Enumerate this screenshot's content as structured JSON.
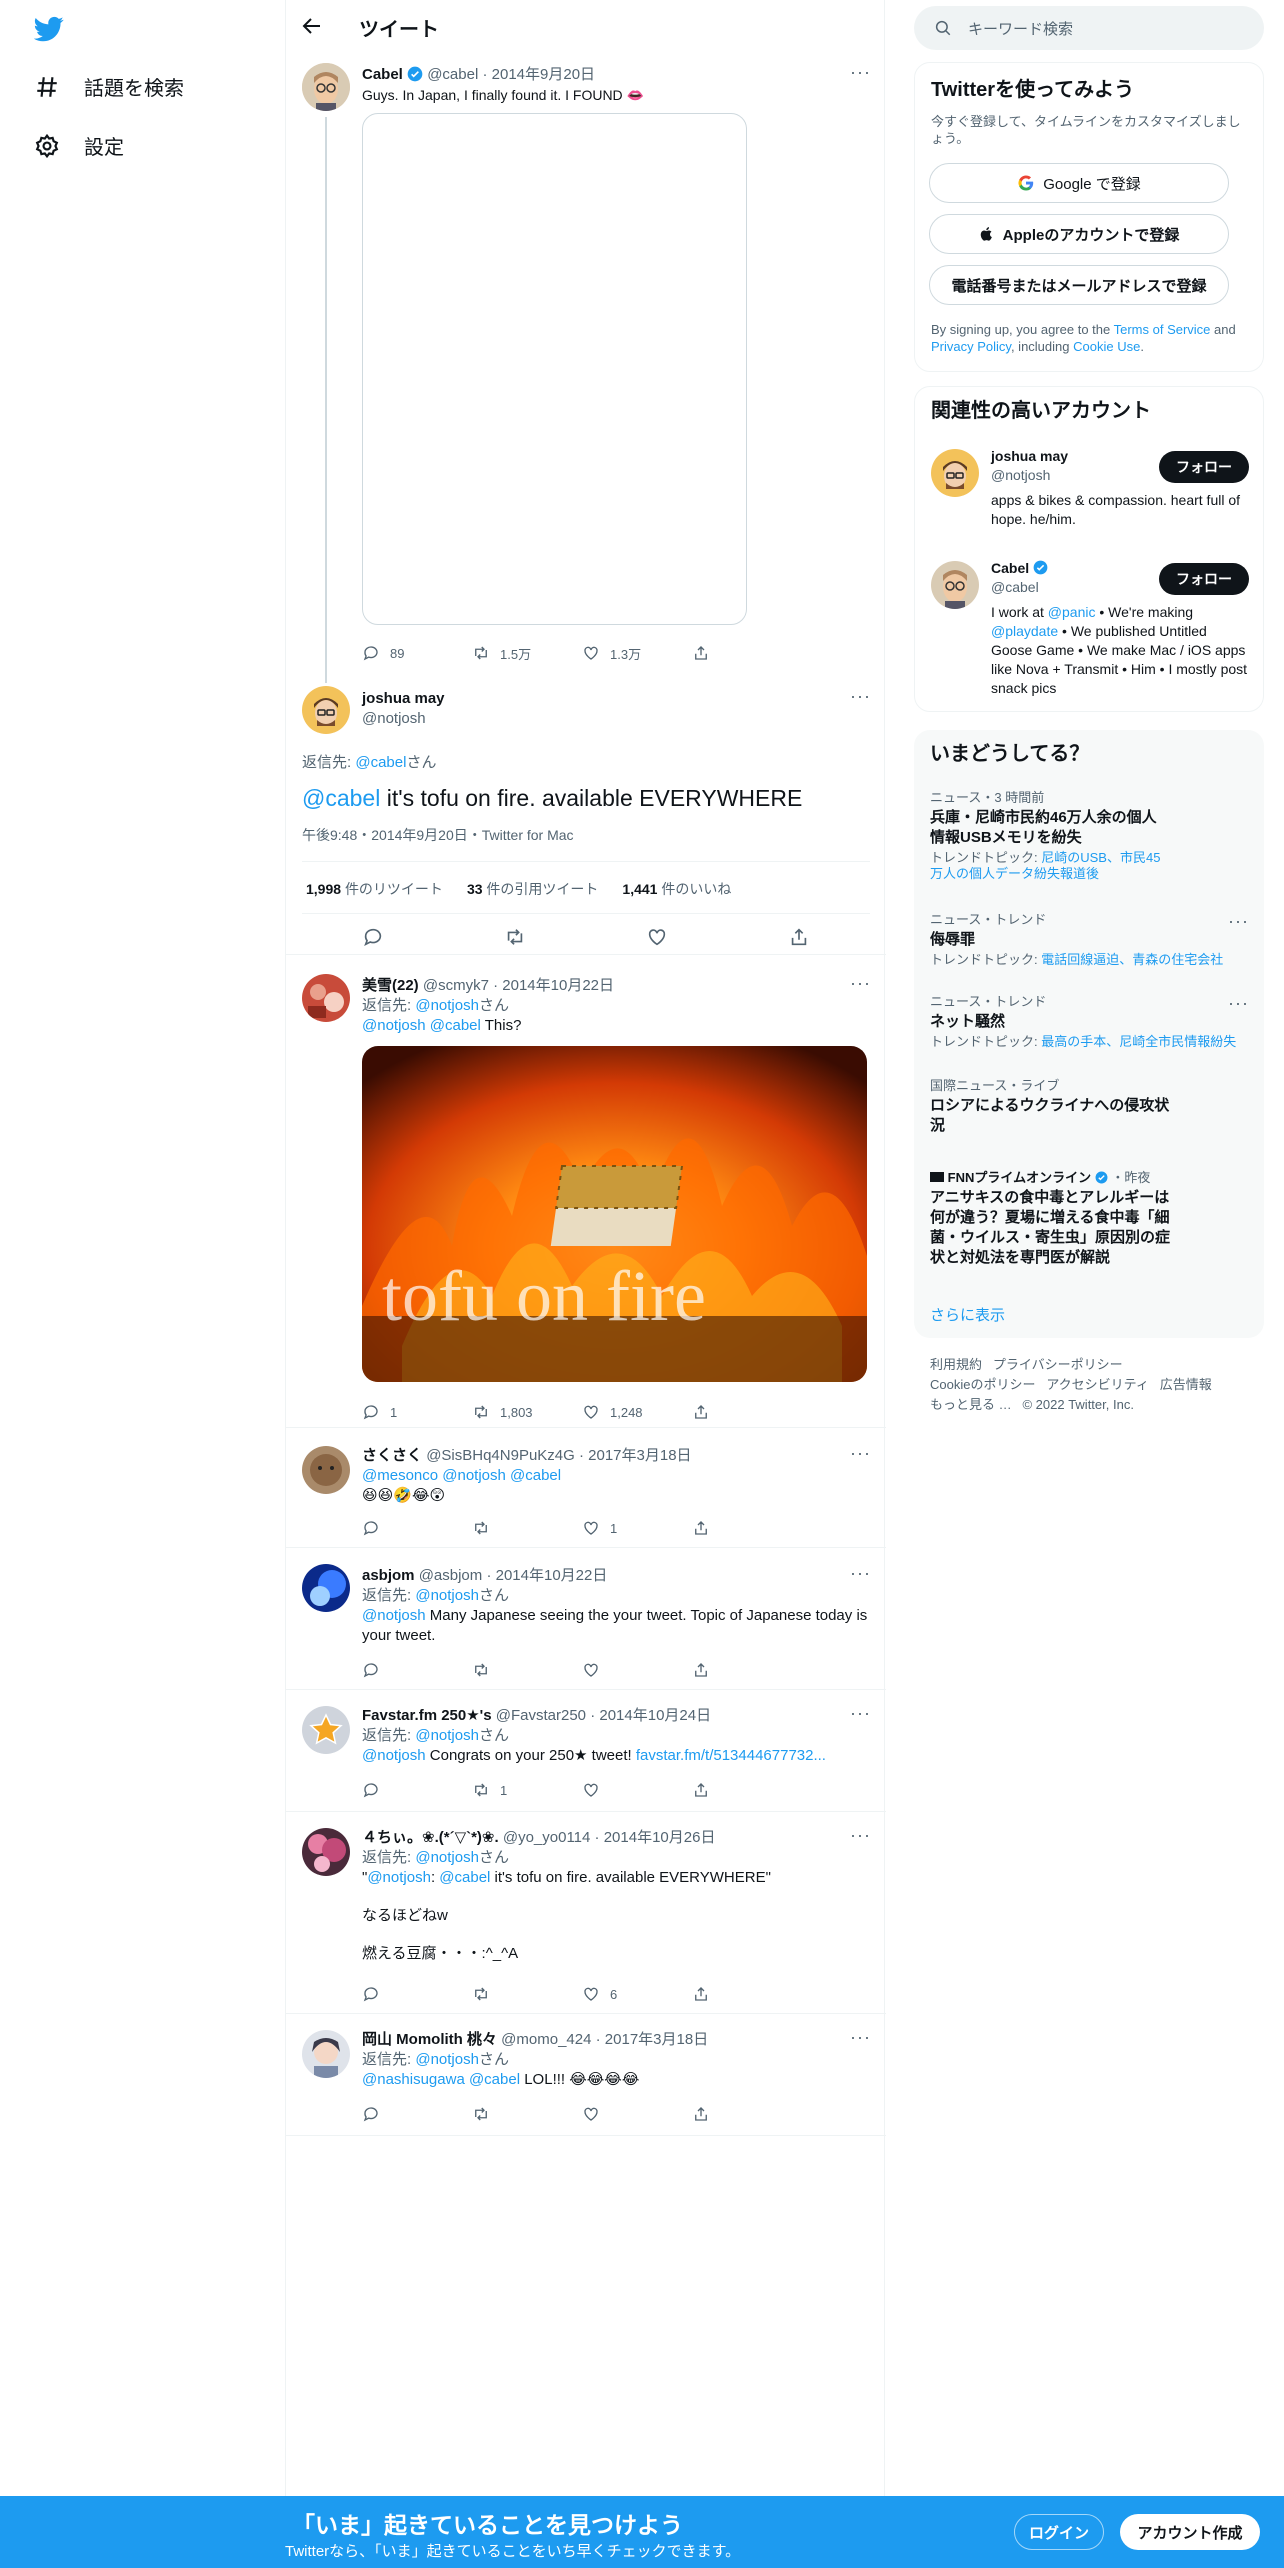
{
  "nav": {
    "items": [
      {
        "label": "話題を検索",
        "icon": "hashtag-icon"
      },
      {
        "label": "設定",
        "icon": "gear-icon"
      }
    ]
  },
  "header": {
    "title": "ツイート"
  },
  "main_tweet": {
    "name": "Cabel",
    "handle": "@cabel",
    "date": "2014年9月20日",
    "text": "Guys. In Japan, I finally found it. I FOUND 👄",
    "replies": "89",
    "retweets": "1.5万",
    "likes": "1.3万"
  },
  "focus_tweet": {
    "name": "joshua may",
    "handle": "@notjosh",
    "reply_prefix": "返信先: ",
    "reply_to": "@cabel",
    "reply_suffix": "さん",
    "mention": "@cabel",
    "text": " it's tofu on fire. available EVERYWHERE",
    "meta": "午後9:48・2014年9月20日・Twitter for Mac",
    "stats": [
      {
        "count": "1,998",
        "label": "件のリツイート"
      },
      {
        "count": "33",
        "label": "件の引用ツイート"
      },
      {
        "count": "1,441",
        "label": "件のいいね"
      }
    ]
  },
  "replies": [
    {
      "name": "美雪(22)",
      "handle": "@scmyk7",
      "date": "2014年10月22日",
      "reply_to": "@notjosh",
      "mentions": "@notjosh @cabel",
      "text": " This?",
      "image_caption": "tofu on fire",
      "reply_count": "1",
      "retweets": "1,803",
      "likes": "1,248"
    },
    {
      "name": "さくさく",
      "handle": "@SisBHq4N9PuKz4G",
      "date": "2017年3月18日",
      "mentions": "@mesonco @notjosh @cabel",
      "text": "😆😆🤣😂😲",
      "reply_count": "",
      "retweets": "",
      "likes": "1"
    },
    {
      "name": "asbjom",
      "handle": "@asbjom",
      "date": "2014年10月22日",
      "reply_to": "@notjosh",
      "mentions": "@notjosh",
      "text": " Many Japanese seeing the your tweet. Topic of Japanese today is your tweet.",
      "reply_count": "",
      "retweets": "",
      "likes": ""
    },
    {
      "name": "Favstar.fm 250★'s",
      "handle": "@Favstar250",
      "date": "2014年10月24日",
      "reply_to": "@notjosh",
      "mentions": "@notjosh",
      "text": " Congrats on your 250★ tweet! ",
      "link": "favstar.fm/t/513444677732...",
      "reply_count": "",
      "retweets": "1",
      "likes": ""
    },
    {
      "name": "４ちぃ。❀.(*´▽`*)❀.",
      "handle": "@yo_yo0114",
      "date": "2014年10月26日",
      "reply_to": "@notjosh",
      "quote_open": "\"",
      "mention1": "@notjosh",
      "colon": ": ",
      "mention2": "@cabel",
      "text": " it's tofu on fire. available EVERYWHERE\"",
      "line2": "なるほどねw",
      "line3": "燃える豆腐・・・:^_^A",
      "reply_count": "",
      "retweets": "",
      "likes": "6"
    },
    {
      "name": "岡山 Momolith 桃々",
      "handle": "@momo_424",
      "date": "2017年3月18日",
      "reply_to": "@notjosh",
      "mentions": "@nashisugawa @cabel",
      "text": " LOL!!! 😂😂😂😂",
      "reply_count": "",
      "retweets": "",
      "likes": ""
    }
  ],
  "right": {
    "search_placeholder": "キーワード検索",
    "signup": {
      "title": "Twitterを使ってみよう",
      "desc": "今すぐ登録して、タイムラインをカスタマイズしましょう。",
      "google": "Google で登録",
      "apple": "Appleのアカウントで登録",
      "phone": "電話番号またはメールアドレスで登録",
      "terms_pre": "By signing up, you agree to the ",
      "terms": "Terms of Service",
      "and": " and ",
      "privacy": "Privacy Policy",
      "including": ", including ",
      "cookie": "Cookie Use",
      "period": "."
    },
    "related": {
      "title": "関連性の高いアカウント",
      "follow": "フォロー",
      "accounts": [
        {
          "name": "joshua may",
          "handle": "@notjosh",
          "bio": "apps & bikes & compassion. heart full of hope. he/him."
        },
        {
          "name": "Cabel",
          "handle": "@cabel",
          "bio_a": "I work at ",
          "bio_m1": "@panic",
          "bio_b": " • We're making ",
          "bio_m2": "@playdate",
          "bio_c": " • We published Untitled Goose Game • We make Mac / iOS apps like Nova + Transmit • Him • I mostly post snack pics"
        }
      ]
    },
    "trends": {
      "title": "いまどうしてる？",
      "items": [
        {
          "cat": "ニュース・3 時間前",
          "title": "兵庫・尼崎市民約46万人余の個人情報USBメモリを紛失",
          "sub_pre": "トレンドトピック: ",
          "sub": "尼崎のUSB、市民45万人の個人データ紛失報道後"
        },
        {
          "cat": "ニュース・トレンド",
          "title": "侮辱罪",
          "sub_pre": "トレンドトピック: ",
          "sub": "電話回線逼迫、青森の住宅会社"
        },
        {
          "cat": "ニュース・トレンド",
          "title": "ネット騒然",
          "sub_pre": "トレンドトピック: ",
          "sub": "最高の手本、尼崎全市民情報紛失"
        },
        {
          "cat": "国際ニュース・ライブ",
          "title": "ロシアによるウクライナへの侵攻状況",
          "sub_pre": "",
          "sub": ""
        },
        {
          "cat": "FNNプライムオンライン",
          "time": "・昨夜",
          "title": "アニサキスの食中毒とアレルギーは何が違う？夏場に増える食中毒「細菌・ウイルス・寄生虫」原因別の症状と対処法を専門医が解説",
          "sub_pre": "",
          "sub": ""
        }
      ],
      "more": "さらに表示"
    },
    "footer": {
      "row1": [
        "利用規約",
        "プライバシーポリシー"
      ],
      "row2": [
        "Cookieのポリシー",
        "アクセシビリティ",
        "広告情報"
      ],
      "more": "もっと見る …",
      "copyright": "© 2022 Twitter, Inc."
    }
  },
  "banner": {
    "title": "「いま」起きていることを見つけよう",
    "subtitle": "Twitterなら、「いま」起きていることをいち早くチェックできます。",
    "login": "ログイン",
    "signup": "アカウント作成"
  },
  "colors": {
    "accent": "#1d9bf0",
    "text": "#0f1419",
    "muted": "#536471"
  }
}
